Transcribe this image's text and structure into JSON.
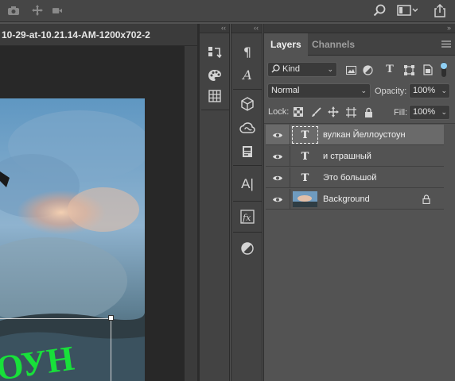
{
  "topbar": {
    "left_icons": [
      "camera-icon",
      "move-transform-icon",
      "video-icon"
    ],
    "right_icons": [
      "search-icon",
      "workspace-icon",
      "share-icon"
    ]
  },
  "document": {
    "tab_label": "10-29-at-10.21.14-AM-1200x702-2",
    "image_caption_text": "ОУН"
  },
  "dock_left": {
    "icons": [
      "history-icon",
      "color-palette-icon",
      "grid-icon"
    ]
  },
  "dock_right": {
    "icons": [
      "paragraph-icon",
      "character-style-icon",
      "3d-cube-icon",
      "creative-cloud-icon",
      "libraries-icon",
      "text-glyph-icon",
      "fx-styles-icon",
      "adjustments-icon"
    ]
  },
  "panel": {
    "tabs": [
      {
        "label": "Layers",
        "active": true
      },
      {
        "label": "Channels",
        "active": false
      }
    ],
    "filter": {
      "value": "Kind"
    },
    "blend_mode": {
      "value": "Normal"
    },
    "opacity": {
      "label": "Opacity:",
      "value": "100%"
    },
    "lock": {
      "label": "Lock:"
    },
    "fill": {
      "label": "Fill:",
      "value": "100%"
    },
    "layers": [
      {
        "name": "вулкан Йеллоустоун",
        "type": "text",
        "thumb": "T",
        "selected": true,
        "locked": false
      },
      {
        "name": "и страшный",
        "type": "text",
        "thumb": "T",
        "selected": false,
        "locked": false
      },
      {
        "name": "Это большой",
        "type": "text",
        "thumb": "T",
        "selected": false,
        "locked": false
      },
      {
        "name": "Background",
        "type": "image",
        "thumb": "",
        "selected": false,
        "locked": true
      }
    ]
  },
  "colors": {
    "panel_bg": "#535353",
    "selected_row": "#6a6a6a",
    "canvas_bg": "#282828",
    "caption_green": "#18e03a"
  }
}
